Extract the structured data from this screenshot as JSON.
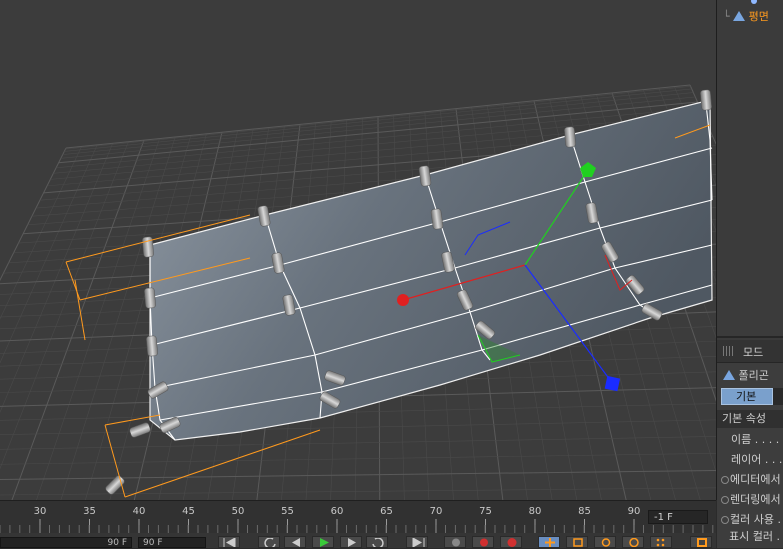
{
  "object_manager": {
    "items": [
      {
        "label": "",
        "icon": "dot-icon"
      },
      {
        "label": "평면",
        "icon": "plane-object-icon"
      }
    ]
  },
  "attribute_manager": {
    "mode_label": "모드",
    "object_type": "폴리곤",
    "tab_basic": "기본",
    "section_title": "기본 속성",
    "fields": [
      {
        "label": "이름 . . . . ."
      },
      {
        "label": "레이어 . . ."
      },
      {
        "label": "에디터에서"
      },
      {
        "label": "렌더링에서"
      },
      {
        "label": "컬러 사용 ."
      },
      {
        "label": "표시 컬러 ."
      }
    ]
  },
  "timeline": {
    "ticks": [
      "30",
      "35",
      "40",
      "45",
      "50",
      "55",
      "60",
      "65",
      "70",
      "75",
      "80",
      "85",
      "90"
    ],
    "frame_field": "-1 F",
    "end_frame": "90 F",
    "max_frame": "90 F"
  },
  "colors": {
    "selection": "#ff9a1e",
    "axis_x": "#e02020",
    "axis_y": "#20d020",
    "axis_z": "#1a2cff",
    "tab_active": "#7aa0cc"
  }
}
